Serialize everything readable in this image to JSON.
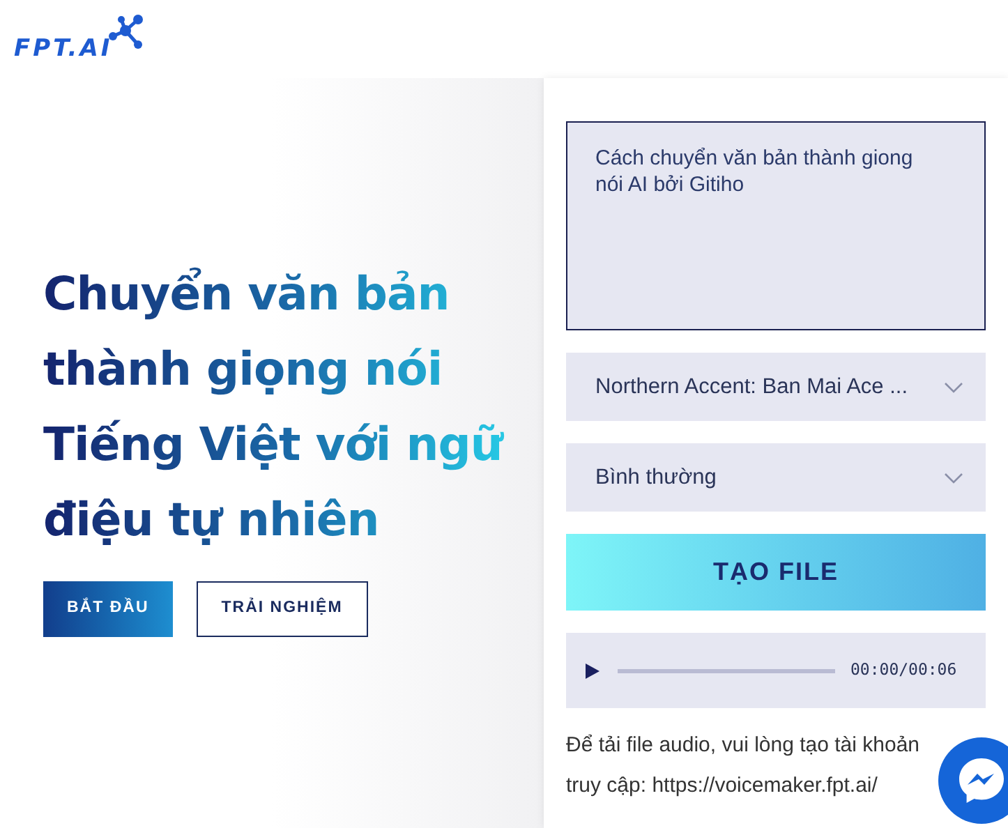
{
  "logo": {
    "text": "FPT.AI"
  },
  "headline": "Chuyển văn bản thành giọng nói Tiếng Việt với ngữ điệu tự nhiên",
  "buttons": [
    {
      "label": "BẮT ĐẦU",
      "kind": "primary"
    },
    {
      "label": "TRẢI NGHIỆM",
      "kind": "outline"
    }
  ],
  "form": {
    "text_value": "Cách chuyển văn bản thành giong nói AI bởi Gitiho",
    "voice_select": "Northern Accent: Ban Mai Ace ...",
    "speed_select": "Bình thường",
    "submit": "TẠO FILE",
    "player": {
      "time": "00:00/00:06"
    },
    "note_lines": [
      "Để tải file audio, vui lòng tạo tài khoản",
      "truy cập: https://voicemaker.fpt.ai/"
    ]
  }
}
